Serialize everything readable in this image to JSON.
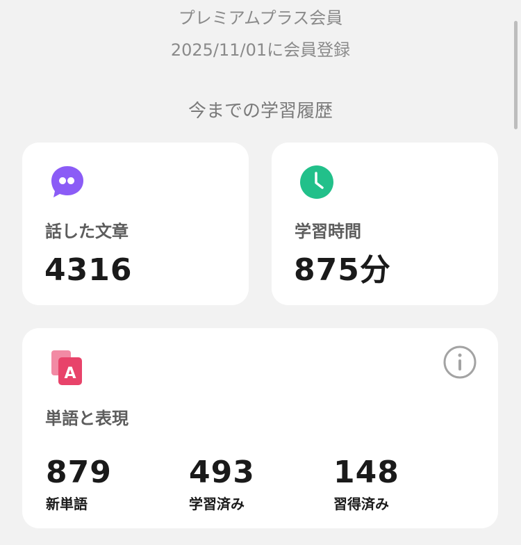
{
  "membership": {
    "plan": "プレミアムプラス会員",
    "since": "2025/11/01に会員登録"
  },
  "history": {
    "title": "今までの学習履歴",
    "sentences": {
      "label": "話した文章",
      "value": "4316",
      "icon": "speech-bubble-quote-icon",
      "color": "#8b5cf6"
    },
    "time": {
      "label": "学習時間",
      "value": "875分",
      "icon": "clock-icon",
      "color": "#22c08a"
    },
    "words": {
      "label": "単語と表現",
      "icon": "flashcard-a-icon",
      "color": "#e8436a",
      "stats": [
        {
          "value": "879",
          "label": "新単語"
        },
        {
          "value": "493",
          "label": "学習済み"
        },
        {
          "value": "148",
          "label": "習得済み"
        }
      ]
    }
  }
}
